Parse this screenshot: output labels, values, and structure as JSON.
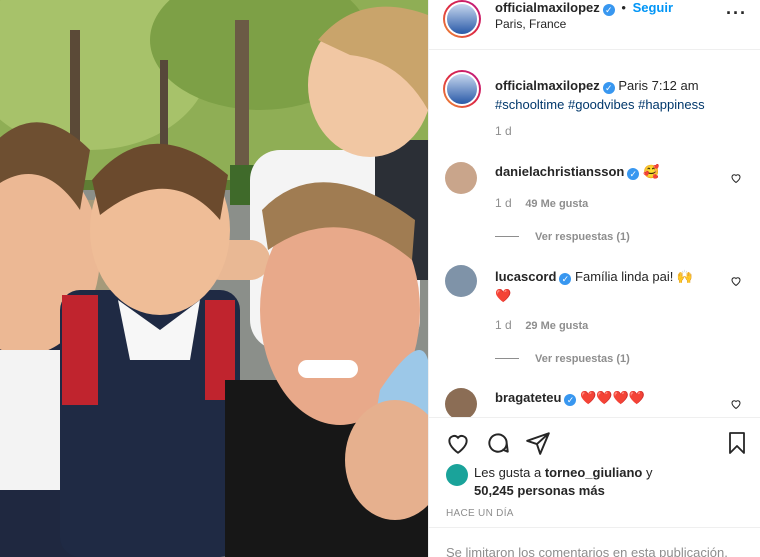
{
  "post": {
    "username": "officialmaxilopez",
    "follow_label": "Seguir",
    "location": "Paris, France",
    "more_icon": "more-horizontal-icon"
  },
  "caption": {
    "username": "officialmaxilopez",
    "text": "Paris 7:12 am",
    "hashtags": "#schooltime #goodvibes #happiness",
    "time": "1 d"
  },
  "comments": [
    {
      "username": "danielachristiansson",
      "text": "🥰",
      "time": "1 d",
      "likes": "49 Me gusta",
      "replies": "Ver respuestas (1)"
    },
    {
      "username": "lucascord",
      "text": "Família linda pai! 🙌",
      "text2": "❤️",
      "time": "1 d",
      "likes": "29 Me gusta",
      "replies": "Ver respuestas (1)"
    },
    {
      "username": "bragateteu",
      "text": "❤️❤️❤️❤️"
    }
  ],
  "likes": {
    "prefix": "Les gusta a",
    "user": "torneo_giuliano",
    "suffix": "y",
    "count": "50,245 personas más"
  },
  "posted": "HACE UN DÍA",
  "footer": "Se limitaron los comentarios en esta publicación."
}
